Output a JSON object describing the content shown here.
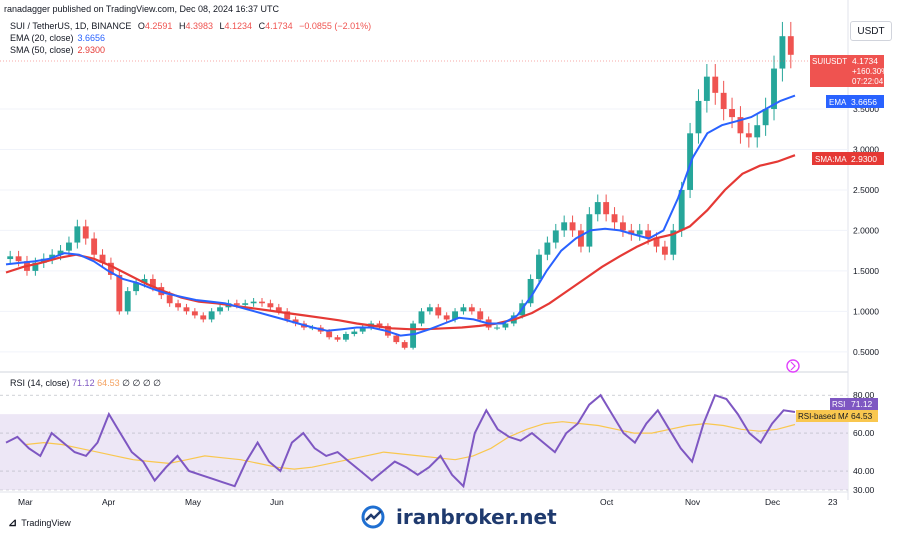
{
  "header": {
    "publisher_text": "ranadagger published on TradingView.com, Dec 08, 2024 16:37 UTC"
  },
  "symbol": {
    "title": "SUI / TetherUS, 1D, BINANCE",
    "open_label": "O",
    "open": "4.2591",
    "high_label": "H",
    "high": "4.3983",
    "low_label": "L",
    "low": "4.1234",
    "close_label": "C",
    "close": "4.1734",
    "change": "−0.0855 (−2.01%)"
  },
  "indicators": {
    "ema_label": "EMA (20, close)",
    "ema_value": "3.6656",
    "sma_label": "SMA (50, close)",
    "sma_value": "2.9300"
  },
  "rsi_legend": {
    "label": "RSI (14, close)",
    "rsi": "71.12",
    "ma": "64.53",
    "extras": "∅ ∅ ∅ ∅"
  },
  "currency_button": "USDT",
  "price_tags": {
    "symbol": "SUIUSDT",
    "price": "4.1734",
    "pct": "+160.30%",
    "countdown": "07:22:04",
    "ema_tag": "EMA",
    "ema_value": "3.6656",
    "sma_tag": "SMA:MA",
    "sma_value": "2.9300",
    "rsi_tag": "RSI",
    "rsi_value": "71.12",
    "rsi_ma_tag": "RSI-based MA",
    "rsi_ma_value": "64.53"
  },
  "colors": {
    "up": "#26a69a",
    "down": "#ef5350",
    "ema": "#2962ff",
    "sma": "#e53935",
    "rsi": "#7e57c2",
    "rsi_ma": "#f9c74f",
    "rsi_band": "#ede7f6"
  },
  "branding": {
    "tv_logo": "TradingView",
    "watermark": "iranbroker.net"
  },
  "chart_data": {
    "type": "line",
    "price": {
      "y_ticks": [
        "0.5000",
        "1.0000",
        "1.5000",
        "2.0000",
        "2.5000",
        "3.0000",
        "3.5000"
      ],
      "y_tick_values": [
        0.5,
        1.0,
        1.5,
        2.0,
        2.5,
        3.0,
        3.5
      ],
      "ylim": [
        0.3,
        4.6
      ],
      "close_approx": [
        1.68,
        1.62,
        1.5,
        1.6,
        1.65,
        1.7,
        1.75,
        1.85,
        2.05,
        1.9,
        1.7,
        1.6,
        1.45,
        1.0,
        1.25,
        1.35,
        1.4,
        1.3,
        1.2,
        1.1,
        1.05,
        1.0,
        0.95,
        0.9,
        1.0,
        1.05,
        1.1,
        1.08,
        1.1,
        1.12,
        1.1,
        1.05,
        1.0,
        0.9,
        0.85,
        0.8,
        0.8,
        0.75,
        0.68,
        0.65,
        0.72,
        0.75,
        0.8,
        0.85,
        0.82,
        0.7,
        0.62,
        0.55,
        0.85,
        1.0,
        1.05,
        0.95,
        0.9,
        1.0,
        1.05,
        1.0,
        0.9,
        0.8,
        0.8,
        0.85,
        0.95,
        1.1,
        1.4,
        1.7,
        1.85,
        2.0,
        2.1,
        2.0,
        1.8,
        2.2,
        2.35,
        2.2,
        2.1,
        2.0,
        1.95,
        2.0,
        1.9,
        1.8,
        1.7,
        2.0,
        2.5,
        3.2,
        3.6,
        3.9,
        3.7,
        3.5,
        3.4,
        3.2,
        3.15,
        3.3,
        3.5,
        4.0,
        4.4,
        4.17
      ],
      "ema20_approx": [
        1.58,
        1.6,
        1.62,
        1.65,
        1.72,
        1.7,
        1.62,
        1.5,
        1.4,
        1.35,
        1.28,
        1.22,
        1.18,
        1.14,
        1.12,
        1.1,
        1.05,
        1.0,
        0.95,
        0.9,
        0.85,
        0.8,
        0.76,
        0.78,
        0.8,
        0.8,
        0.76,
        0.7,
        0.72,
        0.78,
        0.85,
        0.92,
        0.9,
        0.85,
        0.85,
        0.95,
        1.2,
        1.5,
        1.75,
        1.9,
        2.0,
        2.02,
        2.0,
        1.95,
        1.9,
        2.0,
        2.4,
        2.9,
        3.2,
        3.3,
        3.35,
        3.4,
        3.5,
        3.6,
        3.6656
      ],
      "sma50_approx": [
        1.48,
        1.55,
        1.6,
        1.66,
        1.7,
        1.65,
        1.56,
        1.45,
        1.34,
        1.25,
        1.17,
        1.12,
        1.1,
        1.07,
        1.04,
        1.01,
        0.98,
        0.95,
        0.92,
        0.89,
        0.85,
        0.82,
        0.79,
        0.78,
        0.78,
        0.79,
        0.8,
        0.82,
        0.85,
        0.9,
        0.98,
        1.1,
        1.25,
        1.4,
        1.55,
        1.68,
        1.8,
        1.9,
        1.95,
        2.05,
        2.25,
        2.5,
        2.7,
        2.8,
        2.85,
        2.93
      ]
    },
    "rsi": {
      "y_ticks": [
        "30.00",
        "40.00",
        "60.00",
        "80.00"
      ],
      "y_tick_values": [
        30,
        40,
        60,
        80
      ],
      "ylim": [
        30,
        88
      ],
      "band": [
        30,
        70
      ],
      "values_approx": [
        55,
        58,
        52,
        48,
        60,
        55,
        50,
        48,
        55,
        70,
        60,
        50,
        45,
        35,
        42,
        48,
        40,
        38,
        36,
        34,
        32,
        45,
        55,
        45,
        40,
        55,
        60,
        52,
        48,
        50,
        45,
        40,
        35,
        40,
        45,
        42,
        38,
        42,
        48,
        38,
        32,
        60,
        72,
        62,
        58,
        56,
        60,
        55,
        50,
        60,
        65,
        75,
        80,
        70,
        60,
        55,
        65,
        72,
        62,
        52,
        45,
        65,
        80,
        78,
        70,
        60,
        55,
        65,
        72,
        71.12
      ],
      "ma_approx": [
        54,
        55,
        54,
        52,
        50,
        48,
        46,
        45,
        44,
        46,
        48,
        47,
        46,
        44,
        42,
        41,
        42,
        44,
        46,
        48,
        50,
        49,
        48,
        47,
        46,
        48,
        52,
        58,
        62,
        65,
        66,
        65,
        64,
        62,
        60,
        60,
        62,
        64,
        65,
        64,
        62,
        61,
        62,
        64.53
      ]
    },
    "x_ticks": [
      "Mar",
      "Apr",
      "May",
      "Jun",
      "Oct",
      "Nov",
      "Dec",
      "23"
    ]
  }
}
